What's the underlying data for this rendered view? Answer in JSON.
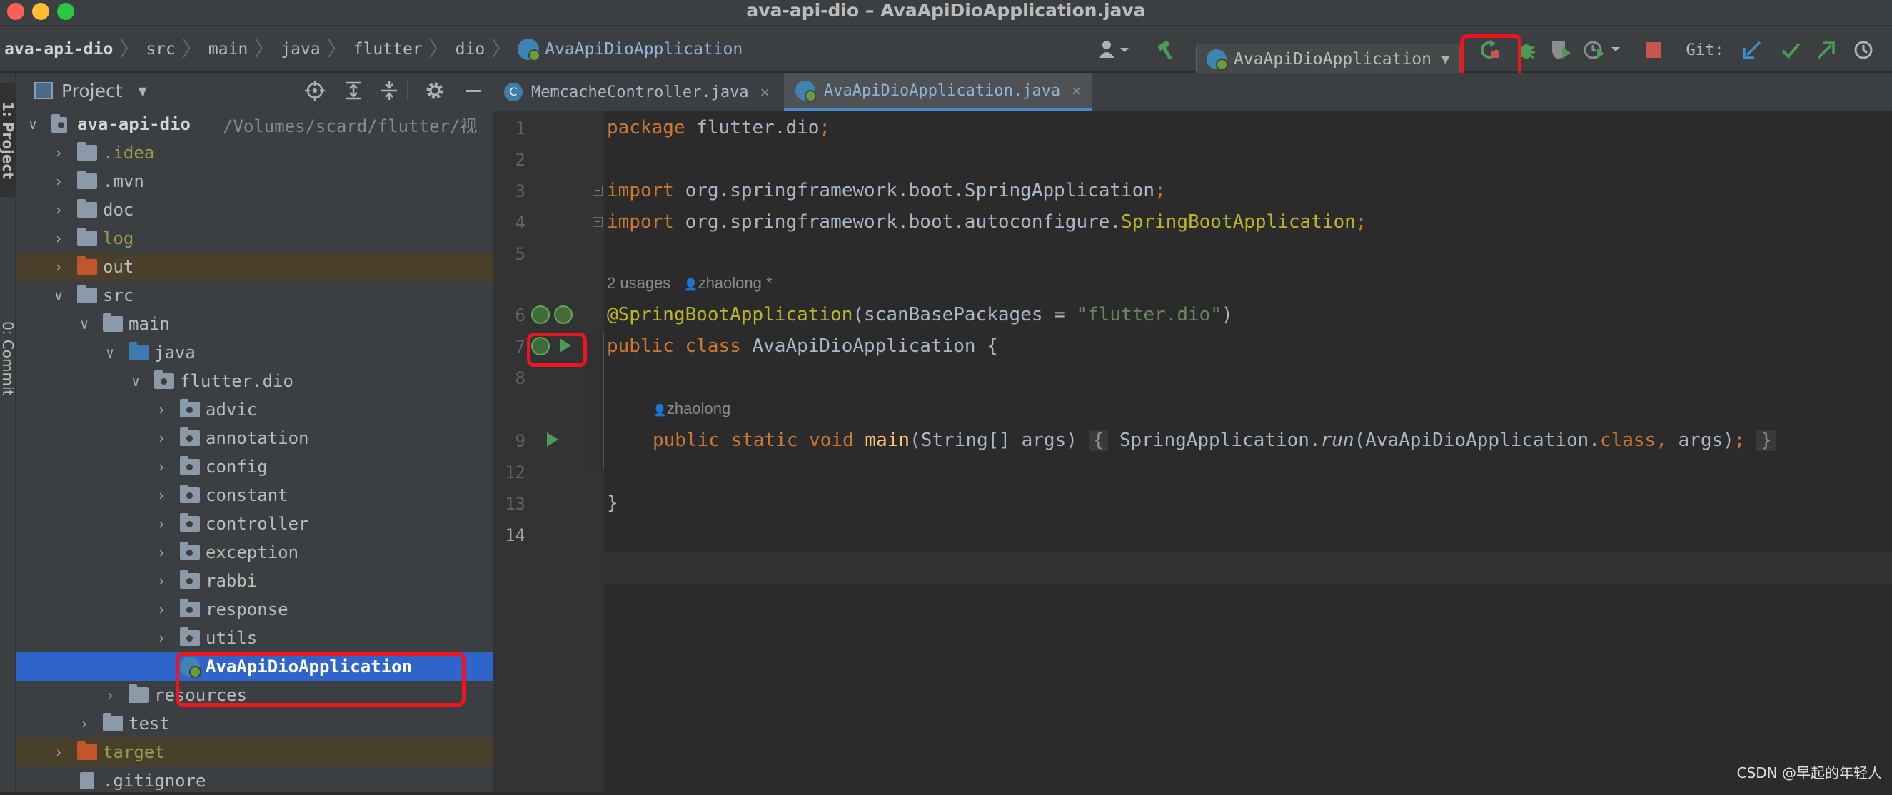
{
  "window": {
    "title": "ava-api-dio – AvaApiDioApplication.java"
  },
  "breadcrumb": [
    "ava-api-dio",
    "src",
    "main",
    "java",
    "flutter",
    "dio",
    "AvaApiDioApplication"
  ],
  "toolbar": {
    "run_config": "AvaApiDioApplication",
    "git_label": "Git:"
  },
  "project_panel": {
    "title": "Project",
    "rows": [
      {
        "label": "ava-api-dio",
        "path": "/Volumes/scard/flutter/视"
      },
      {
        "label": ".idea"
      },
      {
        "label": ".mvn"
      },
      {
        "label": "doc"
      },
      {
        "label": "log"
      },
      {
        "label": "out"
      },
      {
        "label": "src"
      },
      {
        "label": "main"
      },
      {
        "label": "java"
      },
      {
        "label": "flutter.dio"
      },
      {
        "label": "advic"
      },
      {
        "label": "annotation"
      },
      {
        "label": "config"
      },
      {
        "label": "constant"
      },
      {
        "label": "controller"
      },
      {
        "label": "exception"
      },
      {
        "label": "rabbi"
      },
      {
        "label": "response"
      },
      {
        "label": "utils"
      },
      {
        "label": "AvaApiDioApplication"
      },
      {
        "label": "resources"
      },
      {
        "label": "test"
      },
      {
        "label": "target"
      },
      {
        "label": ".gitignore"
      }
    ]
  },
  "left_strip": {
    "project_tab": "1: Project",
    "commit_tab": "0: Commit"
  },
  "editor": {
    "tabs": [
      {
        "label": "MemcacheController.java",
        "icon": "C"
      },
      {
        "label": "AvaApiDioApplication.java"
      }
    ],
    "line_numbers": [
      "1",
      "2",
      "3",
      "4",
      "5",
      "6",
      "7",
      "8",
      "9",
      "12",
      "13",
      "14"
    ],
    "code": {
      "l1_kw": "package",
      "l1_rest": " flutter.dio",
      "l1_semi": ";",
      "l3_kw": "import",
      "l3_rest": " org.springframework.boot.SpringApplication",
      "l3_semi": ";",
      "l4_kw": "import",
      "l4_rest": " org.springframework.boot.autoconfigure.",
      "l4_ann": "SpringBootApplication",
      "l4_semi": ";",
      "usages_hint": "2 usages",
      "author_hint": "zhaolong *",
      "l6_ann": "@SpringBootApplication",
      "l6_open": "(scanBasePackages = ",
      "l6_str": "\"flutter.dio\"",
      "l6_close": ")",
      "l7_kw": "public class",
      "l7_rest": " AvaApiDioApplication {",
      "author_hint2": "zhaolong",
      "l9_kw": "public static void",
      "l9_fn": "main",
      "l9_params": "(String[] args)",
      "l9_body_open": "{",
      "l9_body1": "SpringApplication.",
      "l9_run": "run",
      "l9_body2": "(AvaApiDioApplication.",
      "l9_class": "class",
      "l9_comma": ",",
      "l9_body3": " args)",
      "l9_semi": ";",
      "l9_body_close": "}",
      "l13": "}"
    }
  },
  "watermark": "CSDN @早起的年轻人",
  "colors": {
    "keyword": "#cc7832",
    "annotation": "#bbb529",
    "string": "#6a8759",
    "selection": "#2f65ca",
    "highlight_box": "#f0141e"
  }
}
